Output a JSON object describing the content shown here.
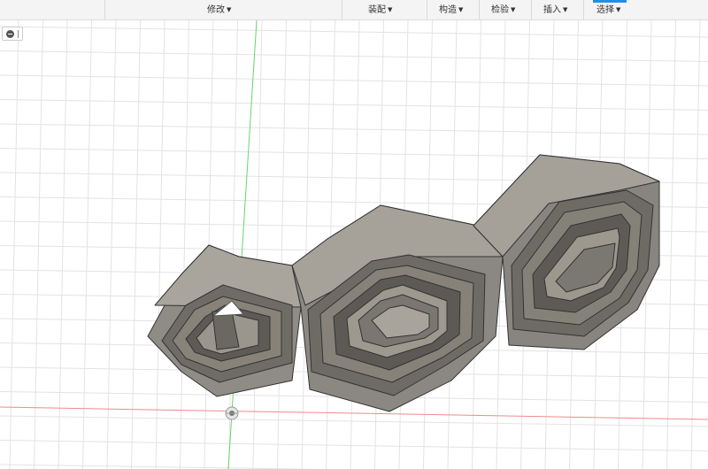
{
  "toolbar": {
    "menus": [
      {
        "label": "修改"
      },
      {
        "label": "装配"
      },
      {
        "label": "构造"
      },
      {
        "label": "检验"
      },
      {
        "label": "插入"
      },
      {
        "label": "选择"
      }
    ],
    "caret": "▼"
  },
  "colors": {
    "grid": "#e3e3e3",
    "y_axis": "#69d36a",
    "x_axis": "#f08a8a",
    "model_face": "#8f8c85",
    "model_edge": "#333333",
    "accent": "#1e90e8"
  },
  "icons": {
    "collapse": "minus-circle-icon",
    "origin": "origin-marker-icon"
  }
}
